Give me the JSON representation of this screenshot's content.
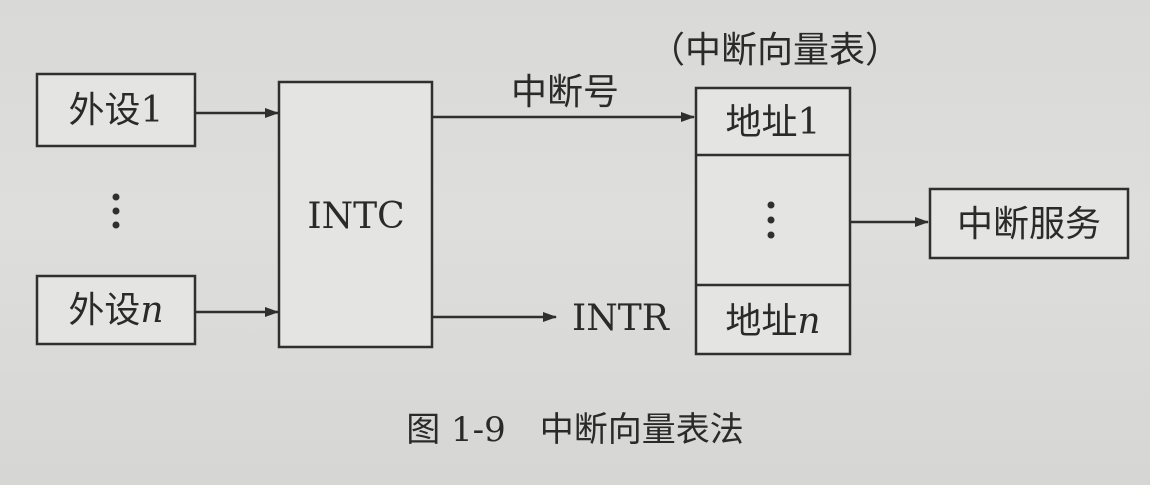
{
  "diagram": {
    "device1": "外设1",
    "device_n_prefix": "外设",
    "device_n_suffix": "n",
    "controller": "INTC",
    "interrupt_number_label": "中断号",
    "table_title": "（中断向量表）",
    "address1": "地址1",
    "address_n_prefix": "地址",
    "address_n_suffix": "n",
    "intr_label": "INTR",
    "service": "中断服务",
    "caption": "图 1-9　中断向量表法"
  }
}
